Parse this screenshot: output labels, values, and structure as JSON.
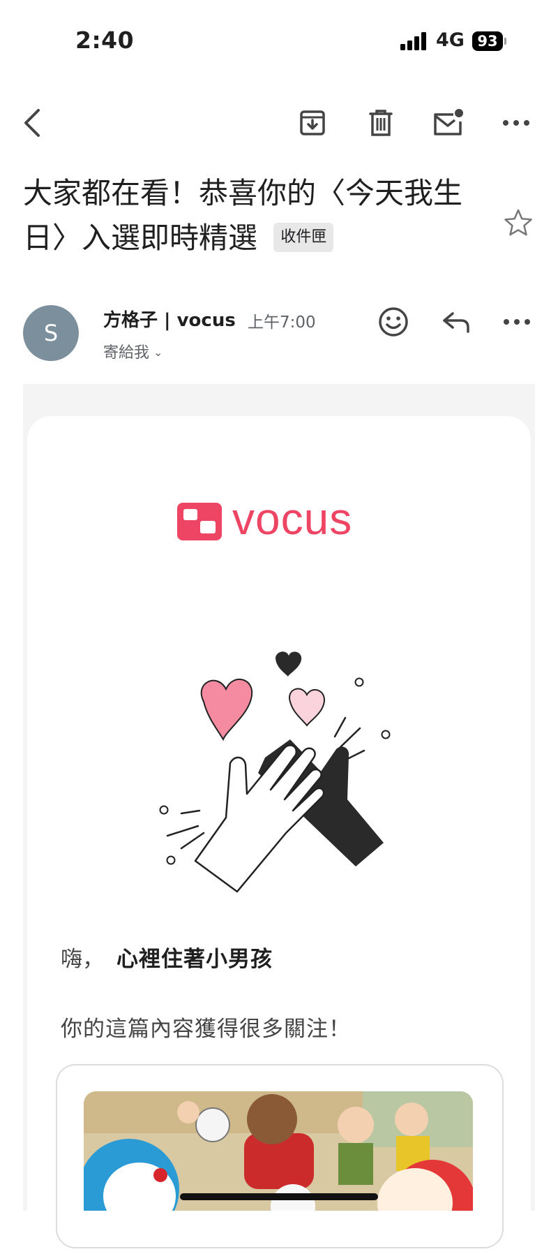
{
  "status_bar": {
    "time": "2:40",
    "network": "4G",
    "battery": "93"
  },
  "toolbar": {
    "back_icon": "chevron-left-icon",
    "archive_icon": "archive-icon",
    "delete_icon": "trash-icon",
    "unread_icon": "mark-unread-icon",
    "more_icon": "more-horizontal-icon"
  },
  "email": {
    "subject": "大家都在看！恭喜你的〈今天我生日〉入選即時精選",
    "label": "收件匣",
    "sender_initial": "S",
    "sender_name": "方格子 | vocus",
    "time": "上午7:00",
    "recipient": "寄給我"
  },
  "body": {
    "logo_text": "vocus",
    "greeting_prefix": "嗨，",
    "greeting_name": "心裡住著小男孩",
    "intro": "你的這篇內容獲得很多關注！"
  },
  "colors": {
    "brand": "#ef4565",
    "avatar": "#7b909c",
    "heart_pink": "#f48ba0",
    "heart_light": "#fbd3dc"
  }
}
